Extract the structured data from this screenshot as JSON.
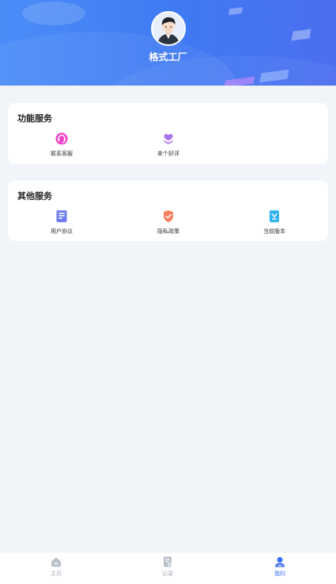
{
  "profile": {
    "username": "格式工厂"
  },
  "function_services": {
    "title": "功能服务",
    "items": [
      {
        "label": "联系客服",
        "icon": "customer-service-icon",
        "color": "#f040c8"
      },
      {
        "label": "来个好评",
        "icon": "heart-flower-icon",
        "color": "#a873ef"
      }
    ]
  },
  "other_services": {
    "title": "其他服务",
    "items": [
      {
        "label": "用户协议",
        "icon": "document-icon",
        "color": "#6b7cf0"
      },
      {
        "label": "隐私政策",
        "icon": "shield-check-icon",
        "color": "#f77e5c"
      },
      {
        "label": "当前版本",
        "icon": "version-icon",
        "color": "#2db1f0"
      }
    ]
  },
  "tabbar": {
    "items": [
      {
        "label": "主页",
        "icon": "home-icon",
        "active": false
      },
      {
        "label": "记录",
        "icon": "records-icon",
        "active": false
      },
      {
        "label": "我的",
        "icon": "user-profile-icon",
        "active": true
      }
    ]
  },
  "colors": {
    "header_gradient_start": "#4a8df7",
    "header_gradient_end": "#4c6ef0",
    "accent": "#3b6ff5",
    "page_background": "#f1f4f8"
  }
}
